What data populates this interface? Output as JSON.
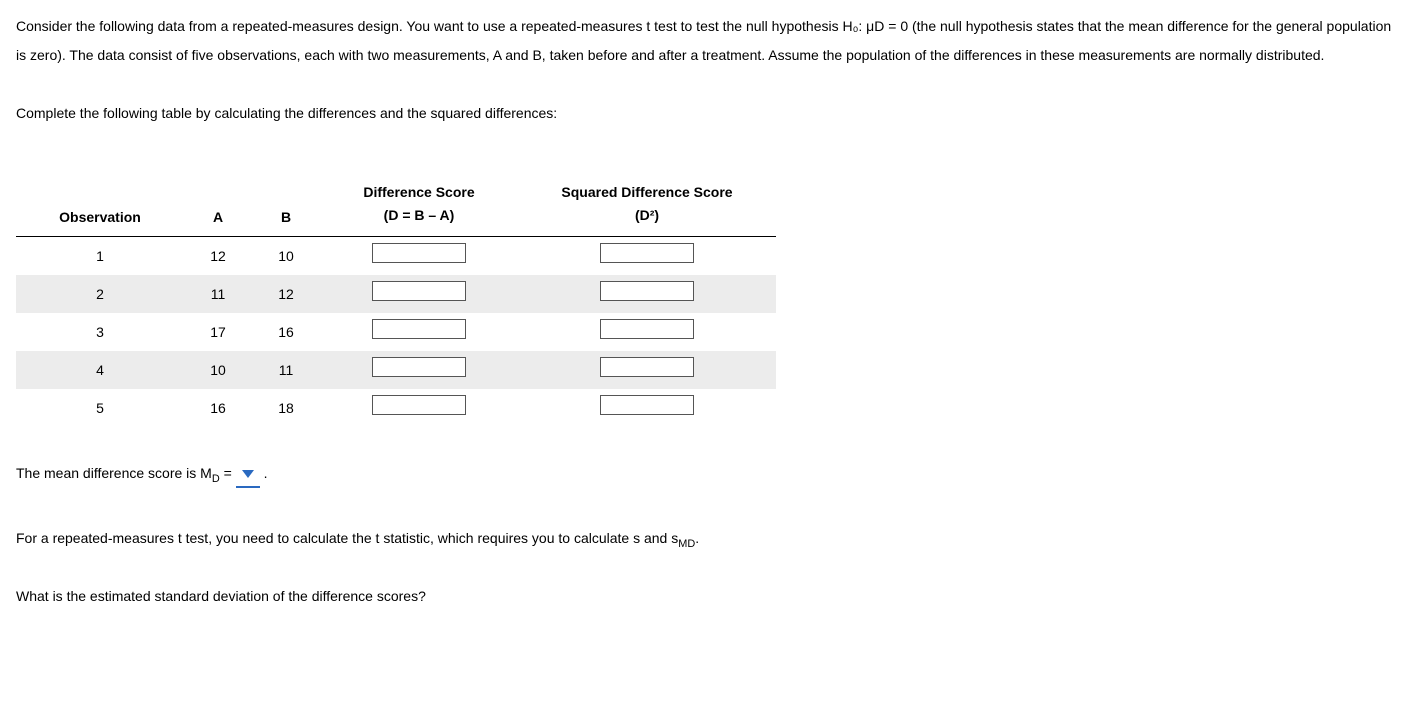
{
  "text": {
    "p1": "Consider the following data from a repeated-measures design. You want to use a repeated-measures t test to test the null hypothesis H₀: μD = 0 (the null hypothesis states that the mean difference for the general population is zero). The data consist of five observations, each with two measurements, A and B, taken before and after a treatment. Assume the population of the differences in these measurements are normally distributed.",
    "p2": "Complete the following table by calculating the differences and the squared differences:",
    "md_prefix": "The mean difference score is M",
    "md_sub": "D",
    "md_eq": " = ",
    "md_period": " .",
    "p3a": "For a repeated-measures t test, you need to calculate the t statistic, which requires you to calculate s and s",
    "p3_sub": "MD",
    "p3b": ".",
    "p4": "What is the estimated standard deviation of the difference scores?"
  },
  "table": {
    "headers": {
      "obs": "Observation",
      "a": "A",
      "b": "B",
      "diff_top": "Difference Score",
      "diff_sub": "(D = B – A)",
      "sq_top": "Squared Difference Score",
      "sq_sub": "(D²)"
    },
    "rows": [
      {
        "obs": "1",
        "a": "12",
        "b": "10"
      },
      {
        "obs": "2",
        "a": "11",
        "b": "12"
      },
      {
        "obs": "3",
        "a": "17",
        "b": "16"
      },
      {
        "obs": "4",
        "a": "10",
        "b": "11"
      },
      {
        "obs": "5",
        "a": "16",
        "b": "18"
      }
    ]
  }
}
